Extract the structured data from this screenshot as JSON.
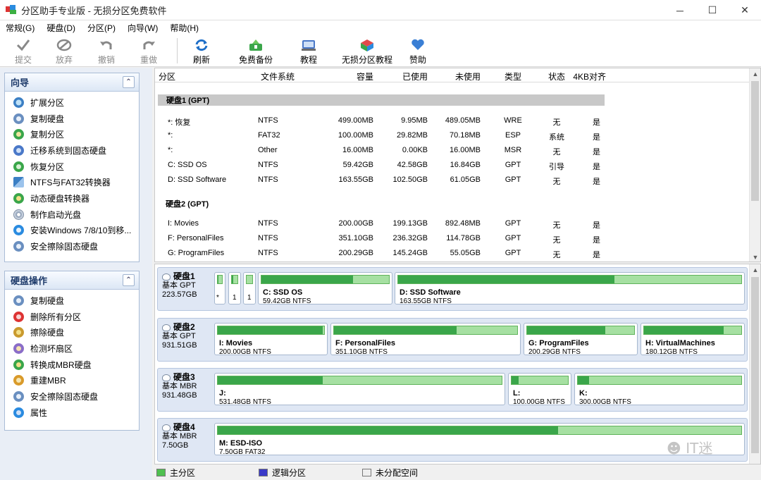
{
  "window": {
    "title": "分区助手专业版 - 无损分区免费软件",
    "controls": [
      "─",
      "☐",
      "✕"
    ]
  },
  "menu": [
    "常规(G)",
    "硬盘(D)",
    "分区(P)",
    "向导(W)",
    "帮助(H)"
  ],
  "toolbar": {
    "buttons": [
      {
        "label": "提交",
        "icon": "checkmark-icon",
        "enabled": false
      },
      {
        "label": "放弃",
        "icon": "discard-icon",
        "enabled": false
      },
      {
        "label": "撤销",
        "icon": "undo-icon",
        "enabled": false
      },
      {
        "label": "重做",
        "icon": "redo-icon",
        "enabled": false
      },
      {
        "label": "刷新",
        "icon": "refresh-icon",
        "enabled": true
      },
      {
        "label": "免费备份",
        "icon": "backup-icon",
        "enabled": true
      },
      {
        "label": "教程",
        "icon": "tutorial-icon",
        "enabled": true
      },
      {
        "label": "无损分区教程",
        "icon": "partition-tutorial-icon",
        "enabled": true
      },
      {
        "label": "赞助",
        "icon": "heart-icon",
        "enabled": true
      }
    ]
  },
  "wizard": {
    "title": "向导",
    "items": [
      "扩展分区",
      "复制硬盘",
      "复制分区",
      "迁移系统到固态硬盘",
      "恢复分区",
      "NTFS与FAT32转换器",
      "动态硬盘转换器",
      "制作启动光盘",
      "安装Windows 7/8/10到移...",
      "安全擦除固态硬盘"
    ]
  },
  "disk_ops": {
    "title": "硬盘操作",
    "items": [
      "复制硬盘",
      "删除所有分区",
      "擦除硬盘",
      "检测坏扇区",
      "转换成MBR硬盘",
      "重建MBR",
      "安全擦除固态硬盘",
      "属性"
    ]
  },
  "table": {
    "headers": [
      "分区",
      "文件系统",
      "容量",
      "已使用",
      "未使用",
      "类型",
      "状态",
      "4KB对齐"
    ],
    "disk1_label": "硬盘1 (GPT)",
    "disk1_rows": [
      [
        "*: 恢复",
        "NTFS",
        "499.00MB",
        "9.95MB",
        "489.05MB",
        "WRE",
        "无",
        "是"
      ],
      [
        "*:",
        "FAT32",
        "100.00MB",
        "29.82MB",
        "70.18MB",
        "ESP",
        "系统",
        "是"
      ],
      [
        "*:",
        "Other",
        "16.00MB",
        "0.00KB",
        "16.00MB",
        "MSR",
        "无",
        "是"
      ],
      [
        "C: SSD OS",
        "NTFS",
        "59.42GB",
        "42.58GB",
        "16.84GB",
        "GPT",
        "引导",
        "是"
      ],
      [
        "D: SSD Software",
        "NTFS",
        "163.55GB",
        "102.50GB",
        "61.05GB",
        "GPT",
        "无",
        "是"
      ]
    ],
    "disk2_label": "硬盘2 (GPT)",
    "disk2_rows": [
      [
        "I: Movies",
        "NTFS",
        "200.00GB",
        "199.13GB",
        "892.48MB",
        "GPT",
        "无",
        "是"
      ],
      [
        "F: PersonalFiles",
        "NTFS",
        "351.10GB",
        "236.32GB",
        "114.78GB",
        "GPT",
        "无",
        "是"
      ],
      [
        "G: ProgramFiles",
        "NTFS",
        "200.29GB",
        "145.24GB",
        "55.05GB",
        "GPT",
        "无",
        "是"
      ]
    ]
  },
  "diskmap": [
    {
      "name": "硬盘1",
      "style": "基本 GPT",
      "size": "223.57GB",
      "parts": [
        {
          "label": "*",
          "size": "",
          "fill": 0.05,
          "tiny": true
        },
        {
          "label": "1",
          "size": "",
          "fill": 0.3,
          "tiny": true
        },
        {
          "label": "1",
          "size": "",
          "fill": 0.0,
          "tiny": true
        },
        {
          "label": "C: SSD OS",
          "size": "59.42GB NTFS",
          "fill": 0.72
        },
        {
          "label": "D: SSD Software",
          "size": "163.55GB NTFS",
          "fill": 0.63
        }
      ]
    },
    {
      "name": "硬盘2",
      "style": "基本 GPT",
      "size": "931.51GB",
      "parts": [
        {
          "label": "I: Movies",
          "size": "200.00GB NTFS",
          "fill": 0.99
        },
        {
          "label": "F: PersonalFiles",
          "size": "351.10GB NTFS",
          "fill": 0.67
        },
        {
          "label": "G: ProgramFiles",
          "size": "200.29GB NTFS",
          "fill": 0.73
        },
        {
          "label": "H: VirtualMachines",
          "size": "180.12GB NTFS",
          "fill": 0.82
        }
      ]
    },
    {
      "name": "硬盘3",
      "style": "基本 MBR",
      "size": "931.48GB",
      "parts": [
        {
          "label": "J:",
          "size": "531.48GB NTFS",
          "fill": 0.37
        },
        {
          "label": "L:",
          "size": "100.00GB NTFS",
          "fill": 0.12
        },
        {
          "label": "K:",
          "size": "300.00GB NTFS",
          "fill": 0.07
        }
      ]
    },
    {
      "name": "硬盘4",
      "style": "基本 MBR",
      "size": "7.50GB",
      "parts": [
        {
          "label": "M: ESD-ISO",
          "size": "7.50GB FAT32",
          "fill": 0.65
        }
      ]
    }
  ],
  "legend": [
    {
      "label": "主分区",
      "color": "#4fc04f"
    },
    {
      "label": "逻辑分区",
      "color": "#3a3ac8"
    },
    {
      "label": "未分配空间",
      "color": "#eeeeee"
    }
  ],
  "watermark": "IT迷"
}
